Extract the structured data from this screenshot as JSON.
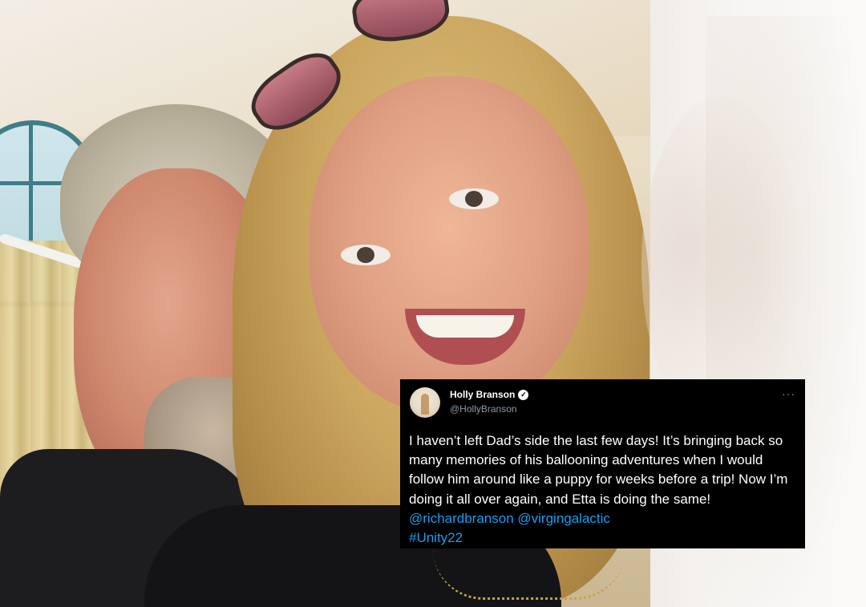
{
  "tweet": {
    "display_name": "Holly Branson",
    "handle": "@HollyBranson",
    "more_label": "···",
    "verified_glyph": "✓",
    "text_plain": "I haven’t left Dad’s side the last few days! It’s bringing back so many memories of his ballooning adventures when I would follow him around like a puppy for weeks before a trip! Now I’m doing it all over again, and Etta is doing the same! ",
    "mention_1": "@richardbranson",
    "mention_2": "@virgingalactic",
    "hashtag": "#Unity22"
  },
  "icons": {
    "verified": "verified-badge-icon",
    "more": "more-options-icon",
    "avatar": "avatar"
  },
  "colors": {
    "card_background": "#000000",
    "link_color": "#1d9bf0",
    "handle_color": "#8b98a5"
  }
}
